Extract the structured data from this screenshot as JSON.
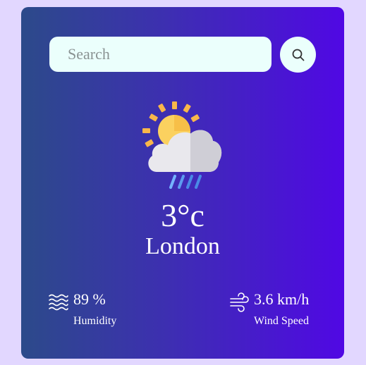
{
  "search": {
    "placeholder": "Search",
    "button_icon": "search-icon"
  },
  "weather": {
    "icon": "partly-cloudy-rain-icon",
    "temperature": "3°c",
    "city": "London"
  },
  "humidity": {
    "icon": "humidity-waves-icon",
    "value": "89 %",
    "label": "Humidity"
  },
  "wind": {
    "icon": "wind-icon",
    "value": "3.6 km/h",
    "label": "Wind Speed"
  },
  "colors": {
    "page_background": "#e2d7ff",
    "card_gradient_start": "#2c4a8a",
    "card_gradient_end": "#5008e4",
    "search_background": "#ebfffc",
    "text": "#ffffff"
  }
}
